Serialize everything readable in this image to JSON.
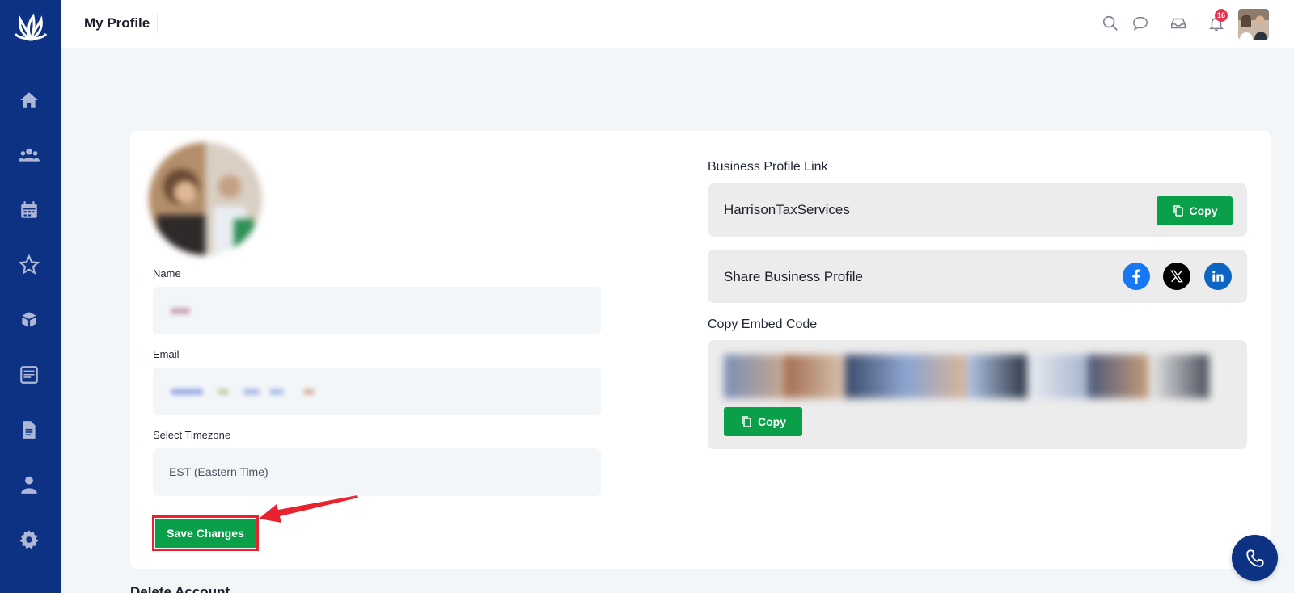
{
  "header": {
    "title": "My Profile",
    "notification_count": "16"
  },
  "sidebar": {
    "items": [
      {
        "icon": "home-icon"
      },
      {
        "icon": "users-icon"
      },
      {
        "icon": "calendar-icon"
      },
      {
        "icon": "star-icon"
      },
      {
        "icon": "box-icon"
      },
      {
        "icon": "newspaper-icon"
      },
      {
        "icon": "document-icon"
      },
      {
        "icon": "user-icon"
      },
      {
        "icon": "gear-icon"
      }
    ]
  },
  "form": {
    "name_label": "Name",
    "email_label": "Email",
    "timezone_label": "Select Timezone",
    "timezone_value": "EST (Eastern Time)",
    "save_label": "Save Changes"
  },
  "business": {
    "link_title": "Business Profile Link",
    "link_value": "HarrisonTaxServices",
    "copy_label": "Copy",
    "share_label": "Share Business Profile",
    "embed_title": "Copy Embed Code",
    "embed_copy_label": "Copy"
  },
  "delete_section": {
    "title": "Delete Account"
  },
  "colors": {
    "sidebar": "#0d3283",
    "accent_green": "#0aa04a",
    "highlight_red": "#e8232f",
    "badge_red": "#e8334f"
  }
}
